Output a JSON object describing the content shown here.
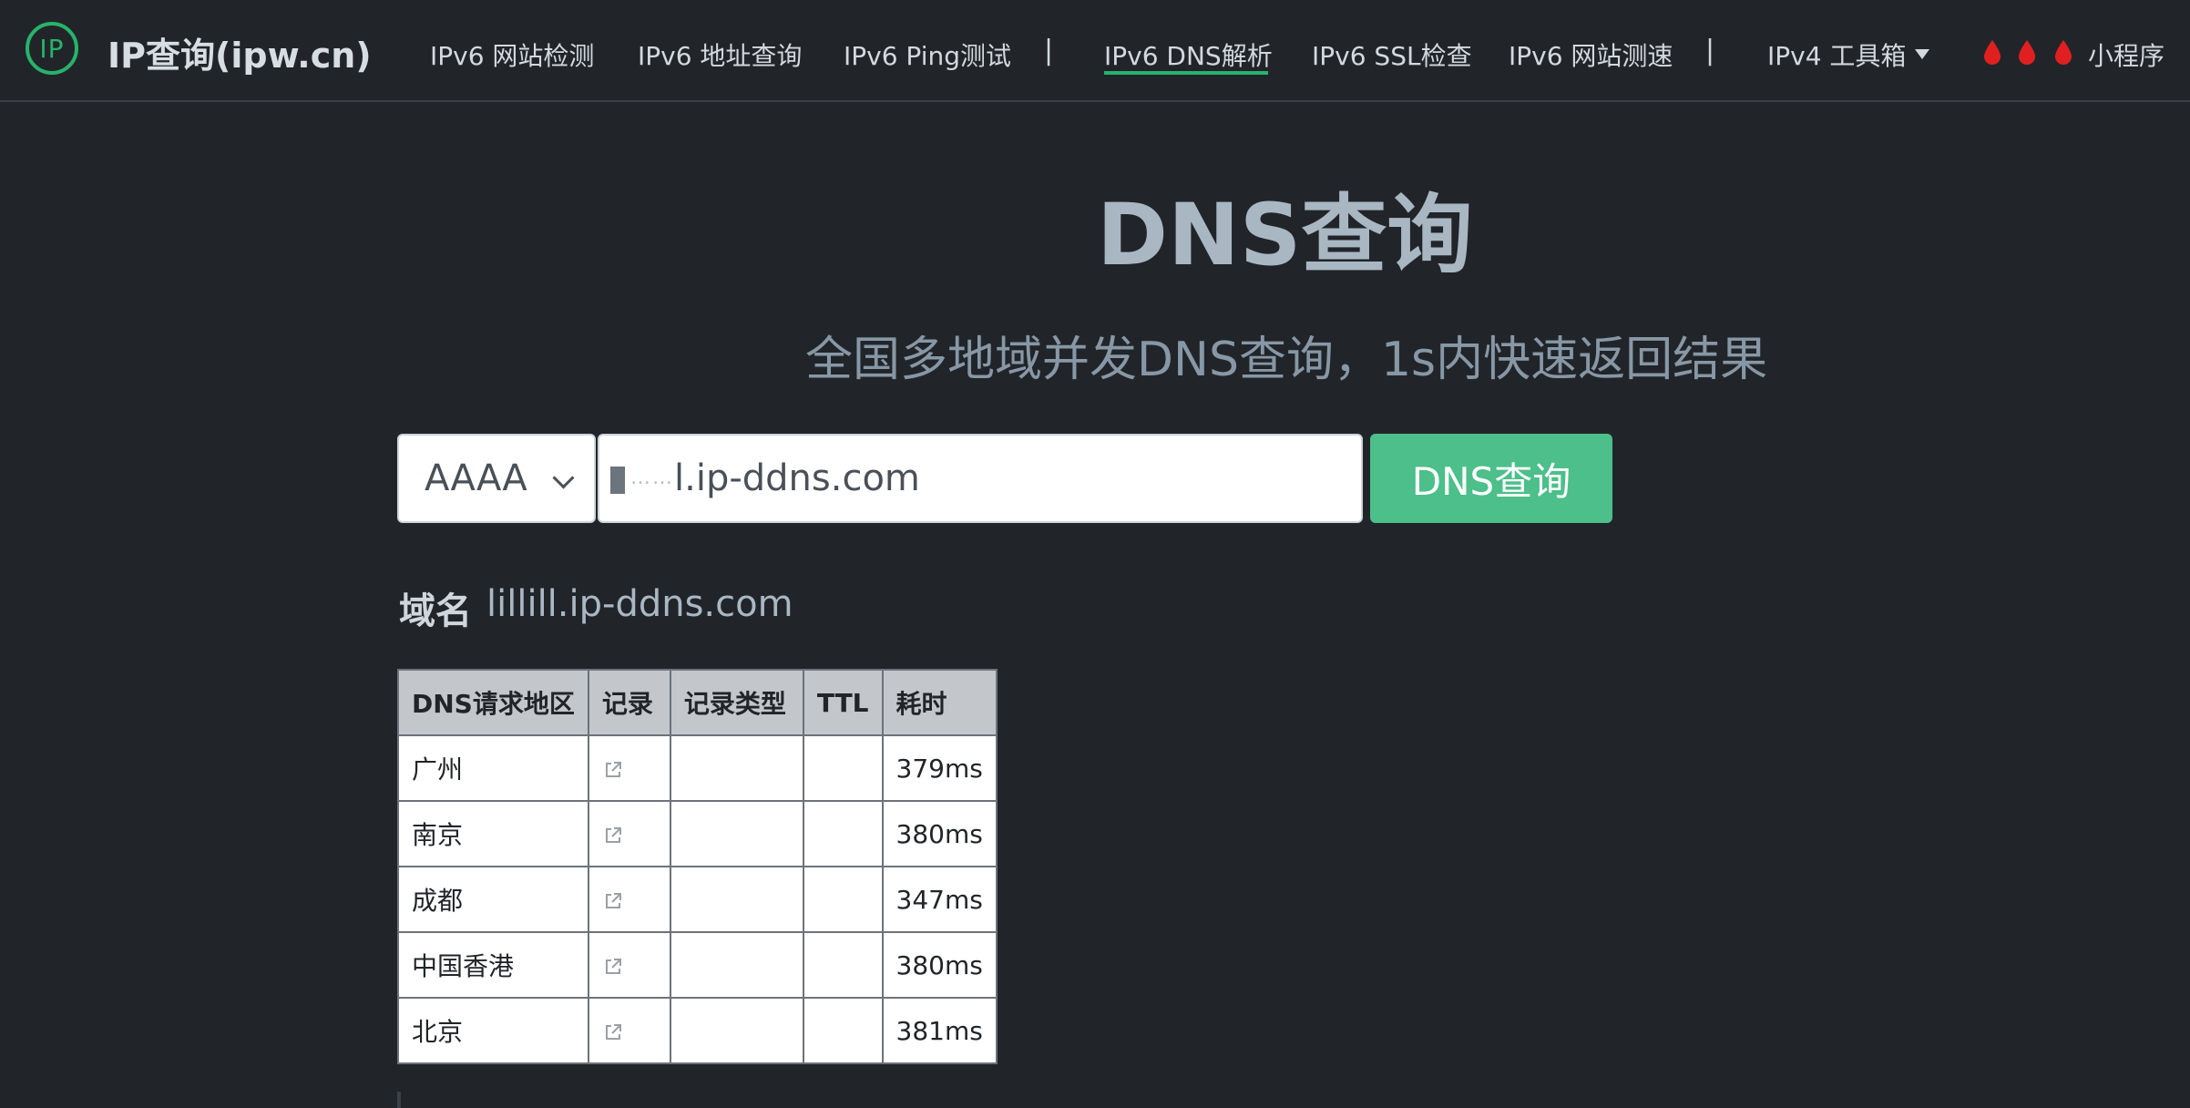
{
  "brand": {
    "logo_text": "IP",
    "name": "IP查询(ipw.cn)"
  },
  "nav": {
    "items": [
      {
        "label": "IPv6 网站检测"
      },
      {
        "label": "IPv6 地址查询"
      },
      {
        "label": "IPv6 Ping测试"
      },
      {
        "label": "IPv6 DNS解析",
        "active": true
      },
      {
        "label": "IPv6 SSL检查"
      },
      {
        "label": "IPv6 网站测速"
      },
      {
        "label": "IPv4 工具箱"
      }
    ],
    "separator": "|",
    "mini_program": "小程序"
  },
  "hero": {
    "title": "DNS查询",
    "subtitle": "全国多地域并发DNS查询，1s内快速返回结果"
  },
  "form": {
    "record_type": "AAAA",
    "input_visible_value": "l.ip-ddns.com",
    "input_masked_prefix": "……",
    "submit_label": "DNS查询"
  },
  "result": {
    "domain_label": "域名",
    "domain_value": "lillill.ip-ddns.com",
    "table": {
      "headers": [
        "DNS请求地区",
        "记录",
        "记录类型",
        "TTL",
        "耗时"
      ],
      "rows": [
        {
          "region": "广州",
          "record": "",
          "type": "",
          "ttl": "",
          "time": "379ms"
        },
        {
          "region": "南京",
          "record": "",
          "type": "",
          "ttl": "",
          "time": "380ms"
        },
        {
          "region": "成都",
          "record": "",
          "type": "",
          "ttl": "",
          "time": "347ms"
        },
        {
          "region": "中国香港",
          "record": "",
          "type": "",
          "ttl": "",
          "time": "380ms"
        },
        {
          "region": "北京",
          "record": "",
          "type": "",
          "ttl": "",
          "time": "381ms"
        }
      ]
    }
  },
  "colors": {
    "background": "#212529",
    "accent_green": "#27b36a",
    "button_green": "#4cbf8a",
    "drop_red": "#e02020"
  },
  "icons": {
    "logo": "ip-logo-icon",
    "dropdown": "caret-down-icon",
    "drop": "blood-drop-icon",
    "external": "external-link-icon"
  }
}
